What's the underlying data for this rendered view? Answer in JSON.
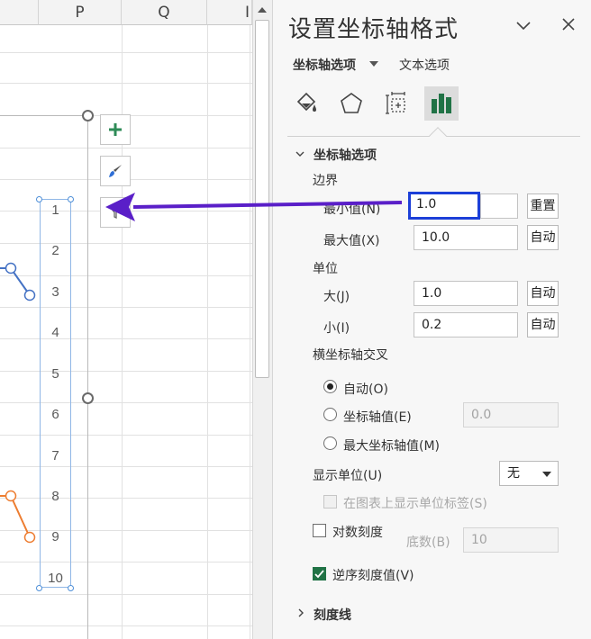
{
  "sheet": {
    "columns": [
      "P",
      "Q",
      "I"
    ],
    "y_axis_ticks": [
      "1",
      "2",
      "3",
      "4",
      "5",
      "6",
      "7",
      "8",
      "9",
      "10"
    ]
  },
  "chart_buttons": {
    "add": "chart-elements",
    "style": "chart-styles",
    "filter": "chart-filters"
  },
  "pane": {
    "title": "设置坐标轴格式",
    "tab_axis_options": "坐标轴选项",
    "tab_text_options": "文本选项",
    "section_axis_options": "坐标轴选项",
    "bounds_label": "边界",
    "min_label": "最小值(N)",
    "min_value": "1.0",
    "min_button": "重置",
    "max_label": "最大值(X)",
    "max_value": "10.0",
    "max_button": "自动",
    "units_label": "单位",
    "major_label": "大(J)",
    "major_value": "1.0",
    "major_button": "自动",
    "minor_label": "小(I)",
    "minor_value": "0.2",
    "minor_button": "自动",
    "crosses_label": "横坐标轴交叉",
    "radio_auto": "自动(O)",
    "radio_axis_value": "坐标轴值(E)",
    "axis_value": "0.0",
    "radio_max_axis": "最大坐标轴值(M)",
    "display_units_label": "显示单位(U)",
    "display_units_value": "无",
    "show_units_label": "在图表上显示单位标签(S)",
    "log_scale_label": "对数刻度",
    "base_label": "底数(B)",
    "base_value": "10",
    "reverse_label": "逆序刻度值(V)",
    "section_tick_marks": "刻度线"
  },
  "colors": {
    "series_blue": "#4472C4",
    "series_orange": "#ED7D31",
    "highlight_box": "#1C3FD8",
    "annotation_arrow": "#5A1FC8",
    "checkbox_checked": "#217346"
  }
}
